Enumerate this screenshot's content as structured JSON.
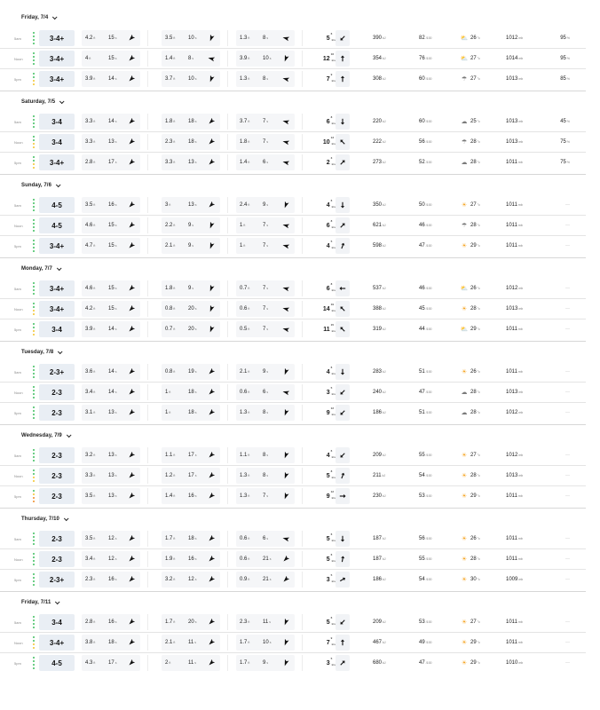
{
  "colors": {
    "good": "#3fbf5f",
    "fair": "#f3c32c",
    "poor": "#ef8a24",
    "sun": "#f5a524",
    "cloud": "#7a7a7a"
  },
  "days": [
    {
      "title": "Friday, 7/4",
      "rows": [
        {
          "time": "5am",
          "ind": [
            "good",
            "good",
            "good",
            "good"
          ],
          "surf": "3-4+",
          "p1h": "4.2",
          "p1p": "15",
          "p1d": 225,
          "p2h": "3.5",
          "p2p": "10",
          "p2d": 200,
          "p3h": "1.3",
          "p3p": "8",
          "p3d": 285,
          "wind": "5",
          "gust": "6",
          "wdir": 225,
          "energy": "390",
          "cons": "82",
          "wicon": "partly",
          "temp": "26",
          "pres": "1012",
          "precip": "95"
        },
        {
          "time": "Noon",
          "ind": [
            "good",
            "good",
            "good",
            "good"
          ],
          "surf": "3-4+",
          "p1h": "4",
          "p1p": "15",
          "p1d": 225,
          "p2h": "1.4",
          "p2p": "8",
          "p2d": 285,
          "p3h": "3.9",
          "p3p": "10",
          "p3d": 200,
          "wind": "12",
          "gust": "16",
          "wdir": 0,
          "energy": "354",
          "cons": "76",
          "wicon": "partly",
          "temp": "27",
          "pres": "1014",
          "precip": "95"
        },
        {
          "time": "5pm",
          "ind": [
            "good",
            "good",
            "fair",
            "fair"
          ],
          "surf": "3-4+",
          "p1h": "3.9",
          "p1p": "14",
          "p1d": 225,
          "p2h": "3.7",
          "p2p": "10",
          "p2d": 200,
          "p3h": "1.3",
          "p3p": "8",
          "p3d": 285,
          "wind": "7",
          "gust": "9",
          "wdir": 0,
          "energy": "308",
          "cons": "60",
          "wicon": "rain",
          "temp": "27",
          "pres": "1013",
          "precip": "85"
        }
      ]
    },
    {
      "title": "Saturday, 7/5",
      "rows": [
        {
          "time": "5am",
          "ind": [
            "good",
            "good",
            "good",
            "good"
          ],
          "surf": "3-4",
          "p1h": "3.3",
          "p1p": "14",
          "p1d": 225,
          "p2h": "1.8",
          "p2p": "18",
          "p2d": 225,
          "p3h": "3.7",
          "p3p": "7",
          "p3d": 285,
          "wind": "6",
          "gust": "8",
          "wdir": 180,
          "energy": "220",
          "cons": "60",
          "wicon": "cloud",
          "temp": "25",
          "pres": "1013",
          "precip": "45"
        },
        {
          "time": "Noon",
          "ind": [
            "good",
            "good",
            "fair",
            "fair"
          ],
          "surf": "3-4",
          "p1h": "3.3",
          "p1p": "13",
          "p1d": 225,
          "p2h": "2.3",
          "p2p": "18",
          "p2d": 225,
          "p3h": "1.8",
          "p3p": "7",
          "p3d": 285,
          "wind": "10",
          "gust": "13",
          "wdir": 315,
          "energy": "222",
          "cons": "56",
          "wicon": "rain",
          "temp": "28",
          "pres": "1013",
          "precip": "75"
        },
        {
          "time": "5pm",
          "ind": [
            "good",
            "good",
            "fair",
            "fair"
          ],
          "surf": "3-4+",
          "p1h": "2.8",
          "p1p": "17",
          "p1d": 225,
          "p2h": "3.3",
          "p2p": "13",
          "p2d": 225,
          "p3h": "1.4",
          "p3p": "6",
          "p3d": 285,
          "wind": "2",
          "gust": "3",
          "wdir": 45,
          "energy": "273",
          "cons": "52",
          "wicon": "cloud",
          "temp": "28",
          "pres": "1011",
          "precip": "75"
        }
      ]
    },
    {
      "title": "Sunday, 7/6",
      "rows": [
        {
          "time": "5am",
          "ind": [
            "good",
            "good",
            "good",
            "good"
          ],
          "surf": "4-5",
          "p1h": "3.5",
          "p1p": "16",
          "p1d": 225,
          "p2h": "3",
          "p2p": "13",
          "p2d": 225,
          "p3h": "2.4",
          "p3p": "9",
          "p3d": 200,
          "wind": "4",
          "gust": "6",
          "wdir": 180,
          "energy": "350",
          "cons": "50",
          "wicon": "sun",
          "temp": "27",
          "pres": "1011",
          "precip": "0"
        },
        {
          "time": "Noon",
          "ind": [
            "good",
            "good",
            "good",
            "good"
          ],
          "surf": "4-5",
          "p1h": "4.6",
          "p1p": "15",
          "p1d": 225,
          "p2h": "2.2",
          "p2p": "9",
          "p2d": 200,
          "p3h": "1",
          "p3p": "7",
          "p3d": 285,
          "wind": "6",
          "gust": "8",
          "wdir": 45,
          "energy": "621",
          "cons": "46",
          "wicon": "rain",
          "temp": "28",
          "pres": "1011",
          "precip": "0"
        },
        {
          "time": "5pm",
          "ind": [
            "good",
            "good",
            "good",
            "good"
          ],
          "surf": "3-4+",
          "p1h": "4.7",
          "p1p": "15",
          "p1d": 225,
          "p2h": "2.1",
          "p2p": "9",
          "p2d": 200,
          "p3h": "1",
          "p3p": "7",
          "p3d": 285,
          "wind": "4",
          "gust": "5",
          "wdir": 20,
          "energy": "598",
          "cons": "47",
          "wicon": "sun",
          "temp": "29",
          "pres": "1011",
          "precip": "0"
        }
      ]
    },
    {
      "title": "Monday, 7/7",
      "rows": [
        {
          "time": "5am",
          "ind": [
            "good",
            "good",
            "good",
            "good"
          ],
          "surf": "3-4+",
          "p1h": "4.6",
          "p1p": "15",
          "p1d": 225,
          "p2h": "1.8",
          "p2p": "9",
          "p2d": 200,
          "p3h": "0.7",
          "p3p": "7",
          "p3d": 285,
          "wind": "6",
          "gust": "8",
          "wdir": 270,
          "energy": "537",
          "cons": "46",
          "wicon": "partly",
          "temp": "26",
          "pres": "1012",
          "precip": "0"
        },
        {
          "time": "Noon",
          "ind": [
            "good",
            "good",
            "fair",
            "fair"
          ],
          "surf": "3-4+",
          "p1h": "4.2",
          "p1p": "15",
          "p1d": 225,
          "p2h": "0.8",
          "p2p": "20",
          "p2d": 200,
          "p3h": "0.6",
          "p3p": "7",
          "p3d": 285,
          "wind": "14",
          "gust": "19",
          "wdir": 315,
          "energy": "388",
          "cons": "45",
          "wicon": "sun",
          "temp": "28",
          "pres": "1013",
          "precip": "0"
        },
        {
          "time": "5pm",
          "ind": [
            "good",
            "good",
            "fair",
            "fair"
          ],
          "surf": "3-4",
          "p1h": "3.9",
          "p1p": "14",
          "p1d": 225,
          "p2h": "0.7",
          "p2p": "20",
          "p2d": 200,
          "p3h": "0.5",
          "p3p": "7",
          "p3d": 285,
          "wind": "11",
          "gust": "15",
          "wdir": 315,
          "energy": "319",
          "cons": "44",
          "wicon": "partly",
          "temp": "29",
          "pres": "1011",
          "precip": "0"
        }
      ]
    },
    {
      "title": "Tuesday, 7/8",
      "rows": [
        {
          "time": "5am",
          "ind": [
            "good",
            "good",
            "good",
            "good"
          ],
          "surf": "2-3+",
          "p1h": "3.6",
          "p1p": "14",
          "p1d": 225,
          "p2h": "0.8",
          "p2p": "19",
          "p2d": 225,
          "p3h": "2.1",
          "p3p": "9",
          "p3d": 200,
          "wind": "4",
          "gust": "6",
          "wdir": 180,
          "energy": "283",
          "cons": "51",
          "wicon": "sun",
          "temp": "26",
          "pres": "1011",
          "precip": "0"
        },
        {
          "time": "Noon",
          "ind": [
            "good",
            "good",
            "good",
            "good"
          ],
          "surf": "2-3",
          "p1h": "3.4",
          "p1p": "14",
          "p1d": 225,
          "p2h": "1",
          "p2p": "18",
          "p2d": 225,
          "p3h": "0.6",
          "p3p": "6",
          "p3d": 285,
          "wind": "3",
          "gust": "5",
          "wdir": 225,
          "energy": "240",
          "cons": "47",
          "wicon": "cloud",
          "temp": "28",
          "pres": "1013",
          "precip": "0"
        },
        {
          "time": "5pm",
          "ind": [
            "good",
            "good",
            "good",
            "good"
          ],
          "surf": "2-3",
          "p1h": "3.1",
          "p1p": "13",
          "p1d": 225,
          "p2h": "1",
          "p2p": "18",
          "p2d": 225,
          "p3h": "1.3",
          "p3p": "8",
          "p3d": 200,
          "wind": "9",
          "gust": "12",
          "wdir": 225,
          "energy": "186",
          "cons": "51",
          "wicon": "cloud",
          "temp": "28",
          "pres": "1012",
          "precip": "0"
        }
      ]
    },
    {
      "title": "Wednesday, 7/9",
      "rows": [
        {
          "time": "5am",
          "ind": [
            "good",
            "good",
            "good",
            "good"
          ],
          "surf": "2-3",
          "p1h": "3.2",
          "p1p": "13",
          "p1d": 225,
          "p2h": "1.1",
          "p2p": "17",
          "p2d": 225,
          "p3h": "1.1",
          "p3p": "8",
          "p3d": 200,
          "wind": "4",
          "gust": "6",
          "wdir": 225,
          "energy": "209",
          "cons": "55",
          "wicon": "sun",
          "temp": "27",
          "pres": "1012",
          "precip": "0"
        },
        {
          "time": "Noon",
          "ind": [
            "good",
            "good",
            "fair",
            "fair"
          ],
          "surf": "2-3",
          "p1h": "3.3",
          "p1p": "13",
          "p1d": 225,
          "p2h": "1.2",
          "p2p": "17",
          "p2d": 225,
          "p3h": "1.3",
          "p3p": "8",
          "p3d": 200,
          "wind": "5",
          "gust": "8",
          "wdir": 20,
          "energy": "211",
          "cons": "54",
          "wicon": "sun",
          "temp": "28",
          "pres": "1013",
          "precip": "0"
        },
        {
          "time": "5pm",
          "ind": [
            "good",
            "fair",
            "poor",
            "poor"
          ],
          "surf": "2-3",
          "p1h": "3.5",
          "p1p": "13",
          "p1d": 225,
          "p2h": "1.4",
          "p2p": "16",
          "p2d": 225,
          "p3h": "1.3",
          "p3p": "7",
          "p3d": 200,
          "wind": "9",
          "gust": "12",
          "wdir": 90,
          "energy": "230",
          "cons": "53",
          "wicon": "sun",
          "temp": "29",
          "pres": "1011",
          "precip": "0"
        }
      ]
    },
    {
      "title": "Thursday, 7/10",
      "rows": [
        {
          "time": "5am",
          "ind": [
            "good",
            "good",
            "good",
            "good"
          ],
          "surf": "2-3",
          "p1h": "3.5",
          "p1p": "12",
          "p1d": 225,
          "p2h": "1.7",
          "p2p": "18",
          "p2d": 225,
          "p3h": "0.6",
          "p3p": "6",
          "p3d": 285,
          "wind": "5",
          "gust": "6",
          "wdir": 180,
          "energy": "187",
          "cons": "56",
          "wicon": "sun",
          "temp": "26",
          "pres": "1011",
          "precip": "0"
        },
        {
          "time": "Noon",
          "ind": [
            "good",
            "good",
            "good",
            "good"
          ],
          "surf": "2-3",
          "p1h": "3.4",
          "p1p": "12",
          "p1d": 225,
          "p2h": "1.9",
          "p2p": "16",
          "p2d": 225,
          "p3h": "0.6",
          "p3p": "21",
          "p3d": 225,
          "wind": "5",
          "gust": "6",
          "wdir": 10,
          "energy": "187",
          "cons": "55",
          "wicon": "sun",
          "temp": "28",
          "pres": "1011",
          "precip": "0"
        },
        {
          "time": "5pm",
          "ind": [
            "good",
            "good",
            "good",
            "good"
          ],
          "surf": "2-3+",
          "p1h": "2.3",
          "p1p": "16",
          "p1d": 225,
          "p2h": "3.2",
          "p2p": "12",
          "p2d": 225,
          "p3h": "0.9",
          "p3p": "21",
          "p3d": 225,
          "wind": "3",
          "gust": "5",
          "wdir": 60,
          "energy": "186",
          "cons": "54",
          "wicon": "sun",
          "temp": "30",
          "pres": "1009",
          "precip": "0"
        }
      ]
    },
    {
      "title": "Friday, 7/11",
      "rows": [
        {
          "time": "5am",
          "ind": [
            "good",
            "good",
            "good",
            "good"
          ],
          "surf": "3-4",
          "p1h": "2.8",
          "p1p": "16",
          "p1d": 225,
          "p2h": "1.7",
          "p2p": "20",
          "p2d": 225,
          "p3h": "2.3",
          "p3p": "11",
          "p3d": 200,
          "wind": "5",
          "gust": "6",
          "wdir": 225,
          "energy": "209",
          "cons": "53",
          "wicon": "sun",
          "temp": "27",
          "pres": "1011",
          "precip": "0"
        },
        {
          "time": "Noon",
          "ind": [
            "good",
            "good",
            "fair",
            "fair"
          ],
          "surf": "3-4+",
          "p1h": "3.8",
          "p1p": "18",
          "p1d": 225,
          "p2h": "2.1",
          "p2p": "11",
          "p2d": 225,
          "p3h": "1.7",
          "p3p": "10",
          "p3d": 200,
          "wind": "7",
          "gust": "9",
          "wdir": 0,
          "energy": "467",
          "cons": "49",
          "wicon": "sun",
          "temp": "29",
          "pres": "1011",
          "precip": "0"
        },
        {
          "time": "5pm",
          "ind": [
            "good",
            "good",
            "good",
            "good"
          ],
          "surf": "4-5",
          "p1h": "4.3",
          "p1p": "17",
          "p1d": 225,
          "p2h": "2",
          "p2p": "11",
          "p2d": 225,
          "p3h": "1.7",
          "p3p": "9",
          "p3d": 200,
          "wind": "3",
          "gust": "5",
          "wdir": 45,
          "energy": "680",
          "cons": "47",
          "wicon": "sun",
          "temp": "29",
          "pres": "1010",
          "precip": "0"
        }
      ]
    }
  ],
  "units": {
    "height": "ft",
    "period": "s",
    "wind": "kts",
    "energy": "kJ",
    "consistency": "/100",
    "temp": "°c",
    "pressure": "mb",
    "precip": "%",
    "precip_none": "—"
  }
}
